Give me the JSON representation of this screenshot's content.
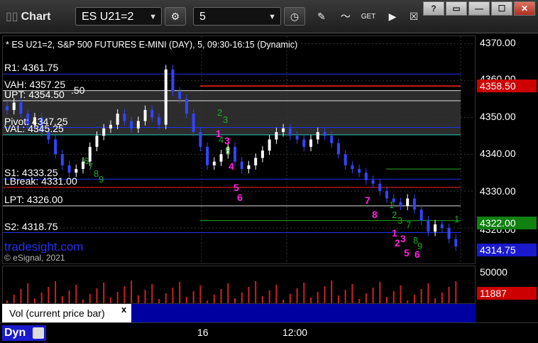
{
  "window": {
    "title": "Chart",
    "symbol": "ES U21=2",
    "interval": "5",
    "win_buttons": [
      "?",
      "▭",
      "—",
      "☐",
      "✕"
    ]
  },
  "chart": {
    "description": "* ES U21=2, S&P 500 FUTURES E-MINI (DAY), 5, 09:30-16:15 (Dynamic)",
    "watermark": "tradesight.com",
    "copyright": "© eSignal, 2021",
    "levels": [
      {
        "label": "R1: 4361.75",
        "price": 4361.75,
        "color": "#2233ee"
      },
      {
        "label": "VAH: 4357.25",
        "price": 4357.25,
        "color": "#dddddd"
      },
      {
        "label": "UPT: 4354.50",
        "price": 4354.5,
        "color": "#dddddd"
      },
      {
        "label": "Pivot: 4347.25",
        "price": 4347.25,
        "color": "#2233ee"
      },
      {
        "label": "VAL: 4345.25",
        "price": 4345.25,
        "color": "#22ccbb"
      },
      {
        "label": "S1: 4333.25",
        "price": 4333.25,
        "color": "#2233ee"
      },
      {
        "label": "LBreak: 4331.00",
        "price": 4331.0,
        "color": "#ff2222"
      },
      {
        "label": "LPT: 4326.00",
        "price": 4326.0,
        "color": "#dddddd"
      },
      {
        "label": "S2: 4318.75",
        "price": 4318.75,
        "color": "#2233ee"
      }
    ],
    "extra_label": ".50"
  },
  "price_axis": {
    "ticks": [
      "4370.00",
      "4360.00",
      "4350.00",
      "4340.00",
      "4330.00",
      "4320.00"
    ],
    "tags": {
      "red": "4358.50",
      "green": "4322.00",
      "blue": "4314.75"
    },
    "volume_tick": "50000",
    "volume_tag": "11887"
  },
  "volume": {
    "legend": "Vol (current price bar)",
    "close": "x"
  },
  "time_axis": {
    "labels": [
      "16",
      "12:00"
    ]
  },
  "footer": {
    "mode": "Dyn"
  },
  "chart_data": {
    "type": "candlestick",
    "ylim": [
      4310,
      4372
    ],
    "annotations_magenta": [
      "1",
      "3",
      "4",
      "5",
      "6",
      "7",
      "8",
      "1",
      "2",
      "3",
      "5",
      "6"
    ],
    "annotations_green": [
      "2",
      "3",
      "4",
      "5",
      "6",
      "7",
      "8",
      "9",
      "1",
      "2",
      "3",
      "7",
      "8",
      "9",
      "1"
    ]
  }
}
